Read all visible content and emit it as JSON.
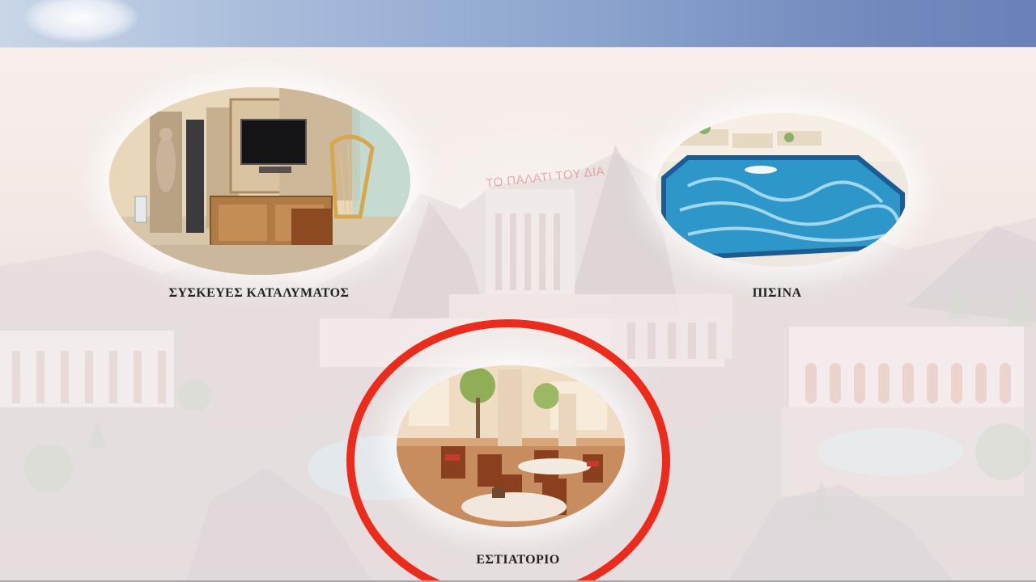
{
  "header": {
    "sky_colors": [
      "#c9d6e8",
      "#6a82b8"
    ]
  },
  "background": {
    "palace_sign": "ΤΟ ΠΑΛΑΤΙ ΤΟΥ ΔΙΑ"
  },
  "menu": {
    "items": [
      {
        "label": "ΣΥΣΚΕΥΕΣ ΚΑΤΑΛΥΜΑΤΟΣ",
        "image": "room-appliances-photo"
      },
      {
        "label": "ΠΙΣΙΝΑ",
        "image": "pool-photo"
      },
      {
        "label": "ΕΣΤΙΑΤΟΡΙΟ",
        "image": "restaurant-photo",
        "highlighted": true
      }
    ]
  },
  "colors": {
    "highlight_ring": "#ee2a1b",
    "caption_text": "#222222"
  }
}
